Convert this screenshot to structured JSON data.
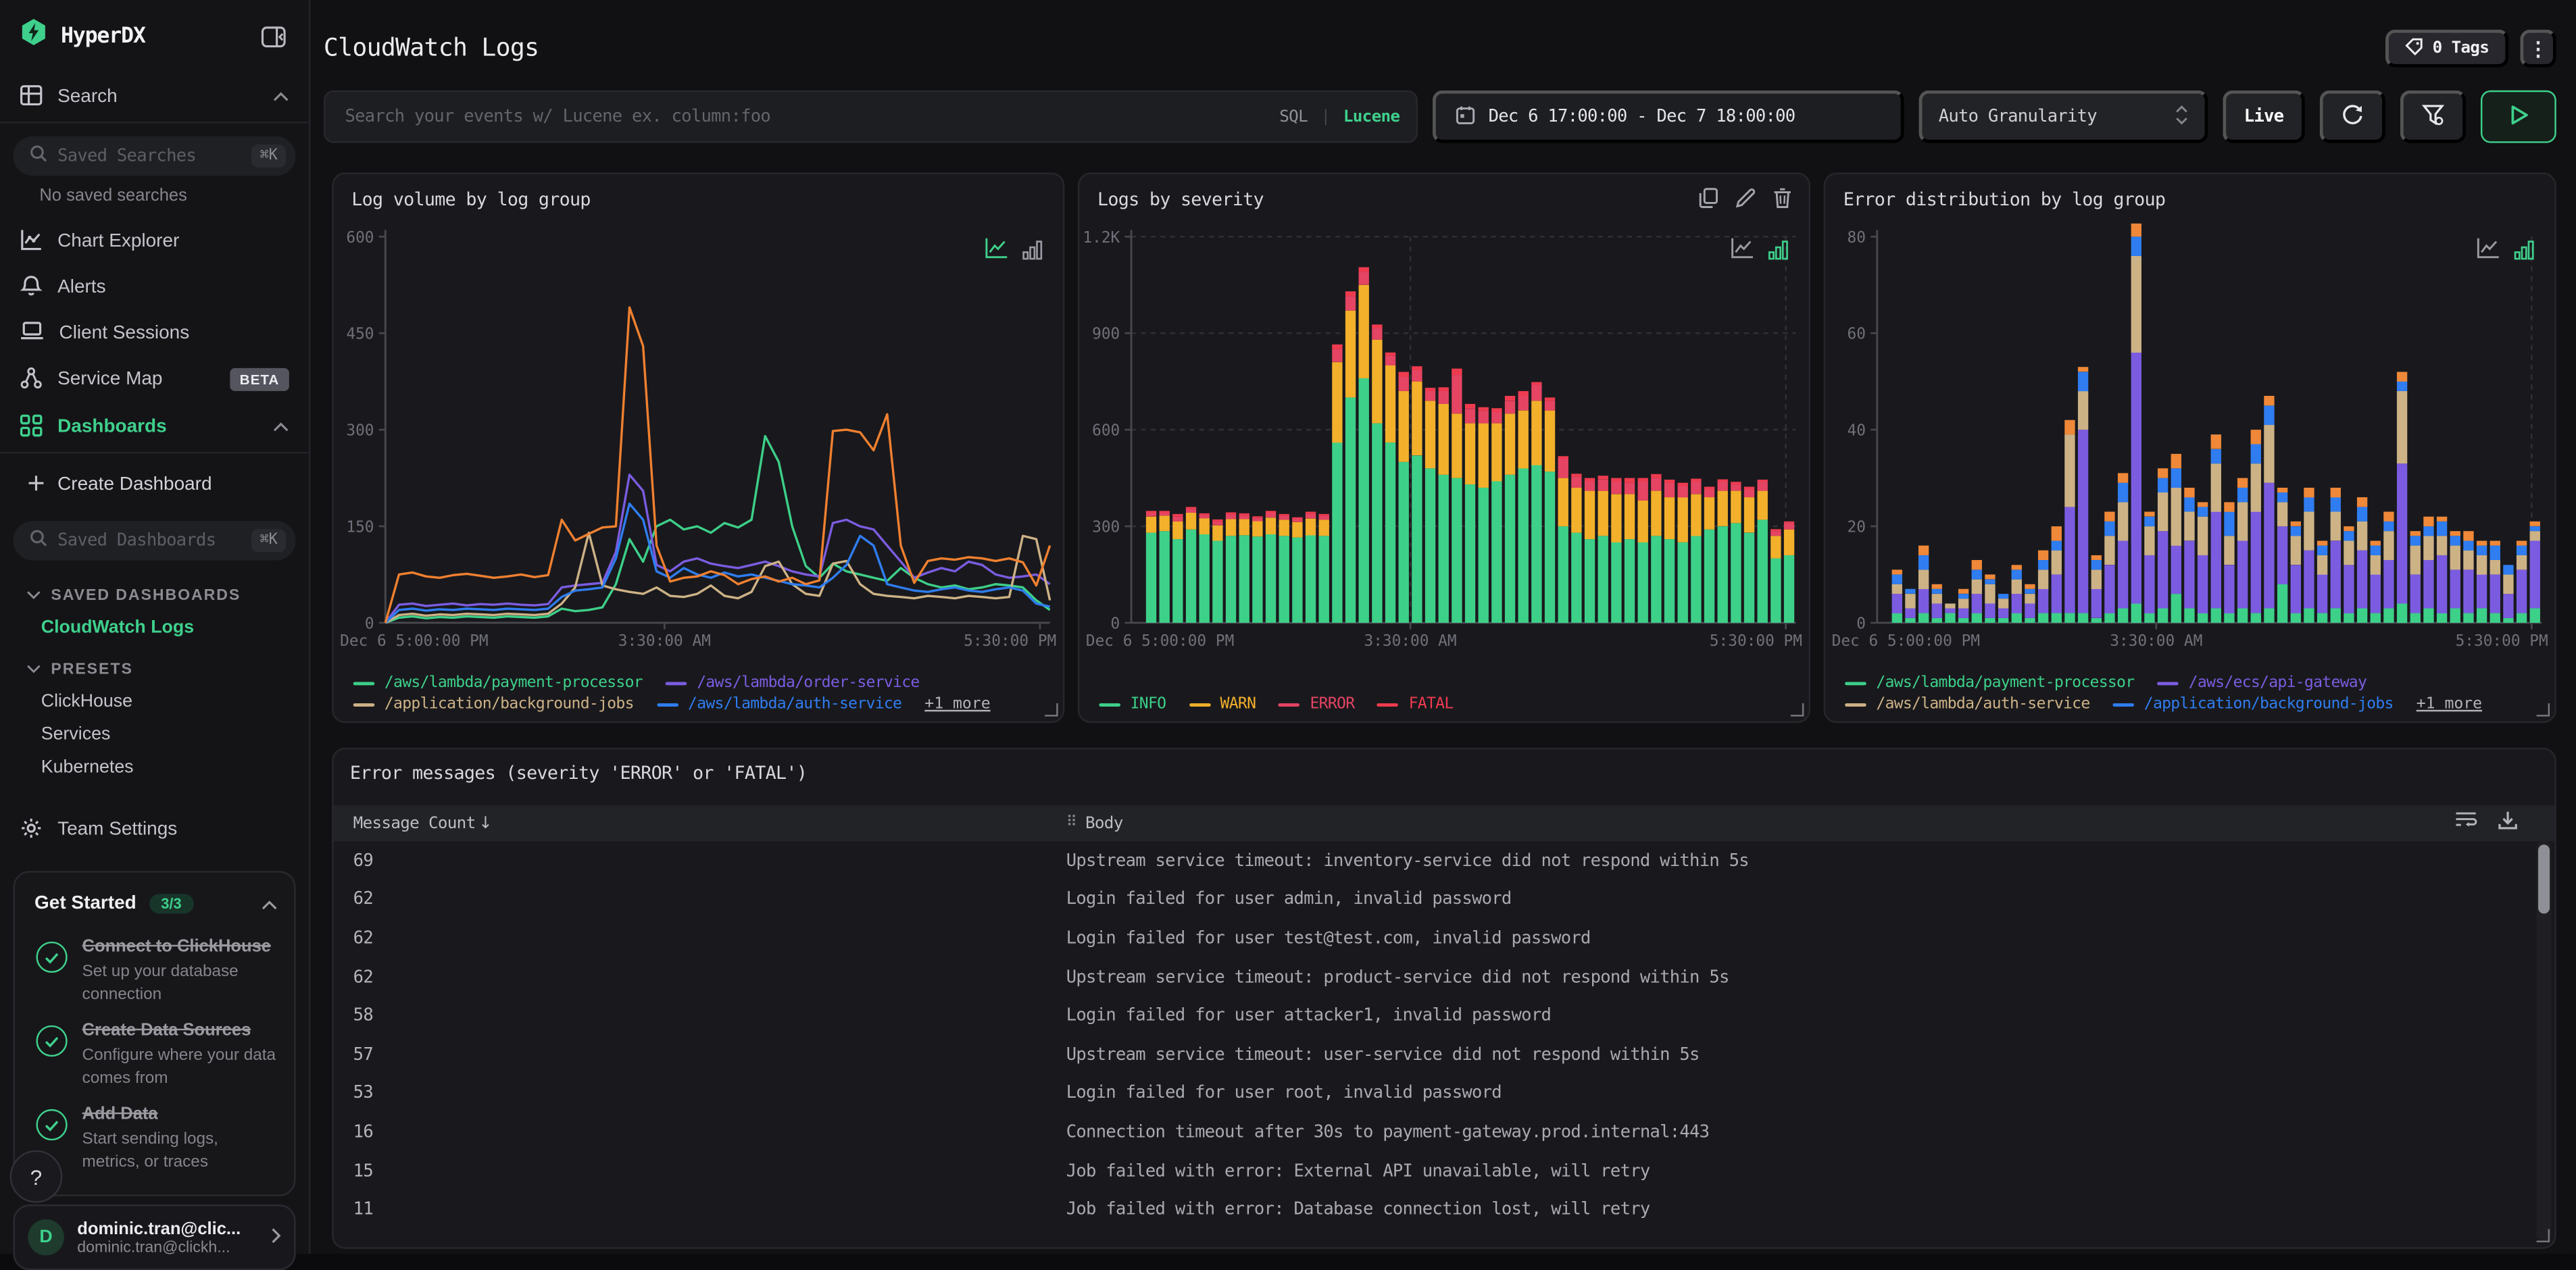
{
  "colors": {
    "accent": "#3fd08c",
    "orange": "#f08030",
    "green": "#3dd089",
    "purple": "#7b5ce0",
    "blue": "#2f7df0",
    "tan": "#cdb286",
    "warn": "#f2b02b",
    "error": "#e54463",
    "fatal": "#ef3b4f"
  },
  "sidebar": {
    "brand": "HyperDX",
    "search_label": "Search",
    "saved_searches_placeholder": "Saved Searches",
    "saved_searches_kbd": "⌘K",
    "no_saved": "No saved searches",
    "nav": [
      {
        "label": "Chart Explorer",
        "icon": "chart-explorer"
      },
      {
        "label": "Alerts",
        "icon": "bell"
      },
      {
        "label": "Client Sessions",
        "icon": "laptop"
      },
      {
        "label": "Service Map",
        "icon": "service-map",
        "badge": "BETA"
      }
    ],
    "dashboards_label": "Dashboards",
    "create_dashboard": "Create Dashboard",
    "saved_dashboards_placeholder": "Saved Dashboards",
    "saved_dashboards_kbd": "⌘K",
    "groups": [
      {
        "label": "SAVED DASHBOARDS",
        "items": [
          {
            "label": "CloudWatch Logs",
            "active": true
          }
        ]
      },
      {
        "label": "PRESETS",
        "items": [
          {
            "label": "ClickHouse"
          },
          {
            "label": "Services"
          },
          {
            "label": "Kubernetes"
          }
        ]
      }
    ],
    "team_settings": "Team Settings",
    "get_started": {
      "title": "Get Started",
      "badge": "3/3",
      "items": [
        {
          "title": "Connect to ClickHouse",
          "desc": "Set up your database connection"
        },
        {
          "title": "Create Data Sources",
          "desc": "Configure where your data comes from"
        },
        {
          "title": "Add Data",
          "desc": "Start sending logs, metrics, or traces"
        }
      ]
    },
    "help": "?",
    "user": {
      "initial": "D",
      "name": "dominic.tran@clic...",
      "email": "dominic.tran@clickh..."
    }
  },
  "header": {
    "title": "CloudWatch Logs",
    "tags_label": "0 Tags"
  },
  "toolbar": {
    "search_placeholder": "Search your events w/ Lucene ex. column:foo",
    "sql": "SQL",
    "sep": "|",
    "lucene": "Lucene",
    "date_range": "Dec 6 17:00:00 - Dec 7 18:00:00",
    "granularity": "Auto Granularity",
    "live": "Live"
  },
  "chart_data": [
    {
      "type": "line",
      "title": "Log volume by log group",
      "ylim": [
        0,
        600
      ],
      "yticks": [
        {
          "v": 0,
          "label": "0"
        },
        {
          "v": 150,
          "label": "150"
        },
        {
          "v": 300,
          "label": "300"
        },
        {
          "v": 450,
          "label": "450"
        },
        {
          "v": 600,
          "label": "600"
        }
      ],
      "xticks": [
        {
          "f": 0,
          "label": "Dec 6 5:00:00 PM",
          "anchor": "start"
        },
        {
          "f": 0.42,
          "label": "3:30:00 AM",
          "anchor": "middle"
        },
        {
          "f": 0.985,
          "label": "5:30:00 PM",
          "anchor": "end"
        }
      ],
      "grid": {
        "h": false,
        "v": false,
        "vlines": []
      },
      "active_mode": "line",
      "more_label": "+1 more",
      "series": [
        {
          "name": "/aws/lambda/payment-processor",
          "color": "#3dd089",
          "values": [
            0,
            8,
            10,
            7,
            9,
            8,
            10,
            9,
            8,
            10,
            9,
            8,
            10,
            22,
            18,
            20,
            24,
            60,
            130,
            95,
            150,
            160,
            145,
            150,
            140,
            155,
            148,
            160,
            290,
            250,
            150,
            88,
            70,
            92,
            80,
            75,
            70,
            65,
            85,
            70,
            60,
            55,
            58,
            52,
            55,
            60,
            58,
            55,
            35,
            20
          ]
        },
        {
          "name": "/aws/lambda/order-service",
          "color": "#7b5ce0",
          "values": [
            0,
            28,
            30,
            26,
            28,
            30,
            27,
            29,
            28,
            30,
            28,
            27,
            29,
            55,
            58,
            60,
            62,
            110,
            230,
            205,
            90,
            80,
            95,
            100,
            92,
            88,
            85,
            90,
            95,
            88,
            80,
            75,
            72,
            155,
            160,
            150,
            145,
            120,
            95,
            70,
            78,
            85,
            80,
            95,
            90,
            75,
            70,
            72,
            75,
            60
          ]
        },
        {
          "name": "/application/background-jobs",
          "color": "#cdb286",
          "values": [
            0,
            12,
            14,
            11,
            13,
            12,
            14,
            13,
            12,
            14,
            13,
            12,
            14,
            30,
            55,
            140,
            58,
            52,
            48,
            45,
            55,
            42,
            40,
            45,
            58,
            42,
            38,
            48,
            88,
            95,
            60,
            45,
            42,
            92,
            96,
            60,
            45,
            42,
            40,
            38,
            42,
            40,
            38,
            42,
            40,
            38,
            40,
            135,
            130,
            35
          ]
        },
        {
          "name": "/aws/lambda/auth-service",
          "color": "#2f7df0",
          "values": [
            0,
            20,
            22,
            19,
            21,
            20,
            22,
            21,
            20,
            22,
            21,
            20,
            22,
            40,
            50,
            52,
            55,
            100,
            185,
            160,
            80,
            70,
            85,
            75,
            70,
            78,
            72,
            75,
            70,
            65,
            60,
            58,
            55,
            70,
            90,
            135,
            120,
            60,
            55,
            50,
            48,
            52,
            55,
            50,
            48,
            52,
            55,
            50,
            30,
            25
          ]
        },
        {
          "name": "/aws/ecs/api-gateway",
          "color": "#f08030",
          "hidden_in_legend": true,
          "values": [
            0,
            75,
            78,
            72,
            70,
            74,
            76,
            73,
            70,
            72,
            75,
            71,
            74,
            160,
            128,
            138,
            148,
            150,
            490,
            430,
            120,
            64,
            70,
            72,
            80,
            74,
            60,
            68,
            72,
            64,
            70,
            60,
            66,
            298,
            300,
            296,
            268,
            324,
            120,
            62,
            96,
            100,
            98,
            102,
            100,
            96,
            100,
            94,
            58,
            120
          ]
        }
      ],
      "legend_rows": [
        [
          0,
          1
        ],
        [
          2,
          3
        ]
      ]
    },
    {
      "type": "bar",
      "title": "Logs by severity",
      "ylim": [
        0,
        1200
      ],
      "yticks": [
        {
          "v": 0,
          "label": "0"
        },
        {
          "v": 300,
          "label": "300"
        },
        {
          "v": 600,
          "label": "600"
        },
        {
          "v": 900,
          "label": "900"
        },
        {
          "v": 1200,
          "label": "1.2K"
        }
      ],
      "xticks": [
        {
          "f": 0,
          "label": "Dec 6 5:00:00 PM",
          "anchor": "start"
        },
        {
          "f": 0.42,
          "label": "3:30:00 AM",
          "anchor": "middle"
        },
        {
          "f": 0.985,
          "label": "5:30:00 PM",
          "anchor": "end"
        }
      ],
      "grid": {
        "h": true,
        "v": true,
        "vlines": [
          0.42,
          0.985
        ]
      },
      "active_mode": "bar",
      "has_hover_actions": true,
      "series": [
        {
          "name": "INFO",
          "color": "#3dd089",
          "values": [
            0,
            280,
            285,
            260,
            290,
            275,
            255,
            270,
            272,
            268,
            275,
            270,
            265,
            272,
            270,
            560,
            700,
            760,
            620,
            560,
            500,
            520,
            480,
            460,
            450,
            430,
            420,
            440,
            460,
            480,
            490,
            470,
            300,
            280,
            260,
            270,
            250,
            260,
            250,
            270,
            260,
            250,
            270,
            290,
            300,
            310,
            280,
            320,
            200,
            210
          ]
        },
        {
          "name": "WARN",
          "color": "#f2b02b",
          "values": [
            0,
            50,
            48,
            55,
            52,
            50,
            48,
            52,
            50,
            48,
            52,
            50,
            48,
            52,
            50,
            250,
            270,
            290,
            260,
            240,
            220,
            230,
            210,
            220,
            200,
            190,
            200,
            180,
            190,
            180,
            200,
            190,
            150,
            140,
            150,
            140,
            150,
            140,
            130,
            140,
            130,
            140,
            130,
            100,
            110,
            100,
            110,
            90,
            70,
            80
          ]
        },
        {
          "name": "ERROR",
          "color": "#e54463",
          "values": [
            0,
            12,
            10,
            15,
            12,
            10,
            12,
            14,
            12,
            10,
            14,
            12,
            10,
            14,
            12,
            40,
            45,
            40,
            35,
            30,
            45,
            35,
            30,
            40,
            120,
            45,
            40,
            35,
            40,
            45,
            50,
            30,
            60,
            35,
            30,
            35,
            40,
            35,
            60,
            40,
            45,
            35,
            40,
            25,
            30,
            20,
            25,
            30,
            15,
            20
          ]
        },
        {
          "name": "FATAL",
          "color": "#ef3b4f",
          "values": [
            0,
            6,
            5,
            8,
            6,
            5,
            6,
            7,
            6,
            5,
            7,
            6,
            5,
            7,
            6,
            15,
            15,
            15,
            12,
            10,
            15,
            12,
            10,
            12,
            20,
            15,
            10,
            12,
            15,
            15,
            8,
            10,
            8,
            8,
            10,
            12,
            10,
            15,
            10,
            12,
            10,
            10,
            8,
            8,
            6,
            8,
            8,
            5,
            6,
            5
          ]
        }
      ],
      "legend_rows": [
        [
          0,
          1,
          2,
          3
        ]
      ]
    },
    {
      "type": "bar",
      "title": "Error distribution by log group",
      "ylim": [
        0,
        80
      ],
      "yticks": [
        {
          "v": 0,
          "label": "0"
        },
        {
          "v": 20,
          "label": "20"
        },
        {
          "v": 40,
          "label": "40"
        },
        {
          "v": 60,
          "label": "60"
        },
        {
          "v": 80,
          "label": "80"
        }
      ],
      "xticks": [
        {
          "f": 0,
          "label": "Dec 6 5:00:00 PM",
          "anchor": "start"
        },
        {
          "f": 0.42,
          "label": "3:30:00 AM",
          "anchor": "middle"
        },
        {
          "f": 0.985,
          "label": "5:30:00 PM",
          "anchor": "end"
        }
      ],
      "grid": {
        "h": false,
        "v": true,
        "vlines": [
          0.985
        ]
      },
      "active_mode": "bar",
      "more_label": "+1 more",
      "series": [
        {
          "name": "/aws/lambda/payment-processor",
          "color": "#3dd089",
          "values": [
            0,
            2,
            1,
            2,
            1,
            2,
            1,
            2,
            1,
            1,
            2,
            1,
            2,
            2,
            2,
            2,
            1,
            2,
            3,
            4,
            2,
            3,
            6,
            3,
            2,
            3,
            2,
            3,
            2,
            3,
            8,
            2,
            3,
            2,
            3,
            2,
            3,
            2,
            3,
            4,
            2,
            3,
            2,
            3,
            2,
            3,
            2,
            1,
            2,
            3
          ]
        },
        {
          "name": "/aws/ecs/api-gateway",
          "color": "#7b5ce0",
          "values": [
            0,
            4,
            2,
            5,
            3,
            1,
            2,
            4,
            3,
            2,
            4,
            3,
            5,
            8,
            22,
            38,
            6,
            10,
            14,
            52,
            12,
            16,
            10,
            14,
            12,
            20,
            10,
            14,
            21,
            26,
            12,
            10,
            12,
            8,
            14,
            10,
            12,
            8,
            10,
            29,
            8,
            10,
            12,
            8,
            9,
            7,
            8,
            5,
            9,
            14
          ]
        },
        {
          "name": "/aws/lambda/auth-service",
          "color": "#cdb286",
          "values": [
            0,
            2,
            3,
            4,
            2,
            1,
            2,
            3,
            4,
            2,
            3,
            2,
            4,
            5,
            15,
            8,
            4,
            6,
            8,
            20,
            6,
            8,
            12,
            6,
            8,
            10,
            6,
            8,
            10,
            12,
            5,
            6,
            8,
            4,
            6,
            5,
            6,
            4,
            6,
            15,
            6,
            5,
            4,
            5,
            4,
            4,
            3,
            4,
            3,
            2
          ]
        },
        {
          "name": "/application/background-jobs",
          "color": "#2f7df0",
          "values": [
            0,
            2,
            1,
            3,
            1,
            0,
            1,
            2,
            1,
            1,
            2,
            1,
            2,
            2,
            0,
            4,
            2,
            3,
            4,
            4,
            2,
            3,
            4,
            3,
            2,
            3,
            5,
            3,
            4,
            4,
            2,
            2,
            3,
            2,
            3,
            2,
            3,
            2,
            2,
            2,
            2,
            2,
            3,
            2,
            2,
            2,
            3,
            2,
            2,
            1
          ]
        },
        {
          "name": "/aws/lambda/order-service",
          "color": "#ef8838",
          "hidden_in_legend": true,
          "values": [
            0,
            1,
            0,
            2,
            1,
            0,
            1,
            2,
            1,
            0,
            1,
            1,
            2,
            3,
            3,
            1,
            1,
            2,
            2,
            4,
            1,
            2,
            3,
            2,
            1,
            3,
            2,
            2,
            3,
            2,
            1,
            1,
            2,
            1,
            2,
            1,
            2,
            1,
            2,
            2,
            1,
            2,
            1,
            1,
            2,
            1,
            1,
            0,
            1,
            1
          ]
        }
      ],
      "legend_rows": [
        [
          0,
          1
        ],
        [
          2,
          3
        ]
      ]
    }
  ],
  "table": {
    "title": "Error messages (severity 'ERROR' or 'FATAL')",
    "columns": {
      "count": "Message Count",
      "body": "Body"
    },
    "rows": [
      {
        "count": "69",
        "body": "Upstream service timeout: inventory-service did not respond within 5s"
      },
      {
        "count": "62",
        "body": "Login failed for user admin, invalid password"
      },
      {
        "count": "62",
        "body": "Login failed for user test@test.com, invalid password"
      },
      {
        "count": "62",
        "body": "Upstream service timeout: product-service did not respond within 5s"
      },
      {
        "count": "58",
        "body": "Login failed for user attacker1, invalid password"
      },
      {
        "count": "57",
        "body": "Upstream service timeout: user-service did not respond within 5s"
      },
      {
        "count": "53",
        "body": "Login failed for user root, invalid password"
      },
      {
        "count": "16",
        "body": "Connection timeout after 30s to payment-gateway.prod.internal:443"
      },
      {
        "count": "15",
        "body": "Job failed with error: External API unavailable, will retry"
      },
      {
        "count": "11",
        "body": "Job failed with error: Database connection lost, will retry"
      }
    ]
  }
}
